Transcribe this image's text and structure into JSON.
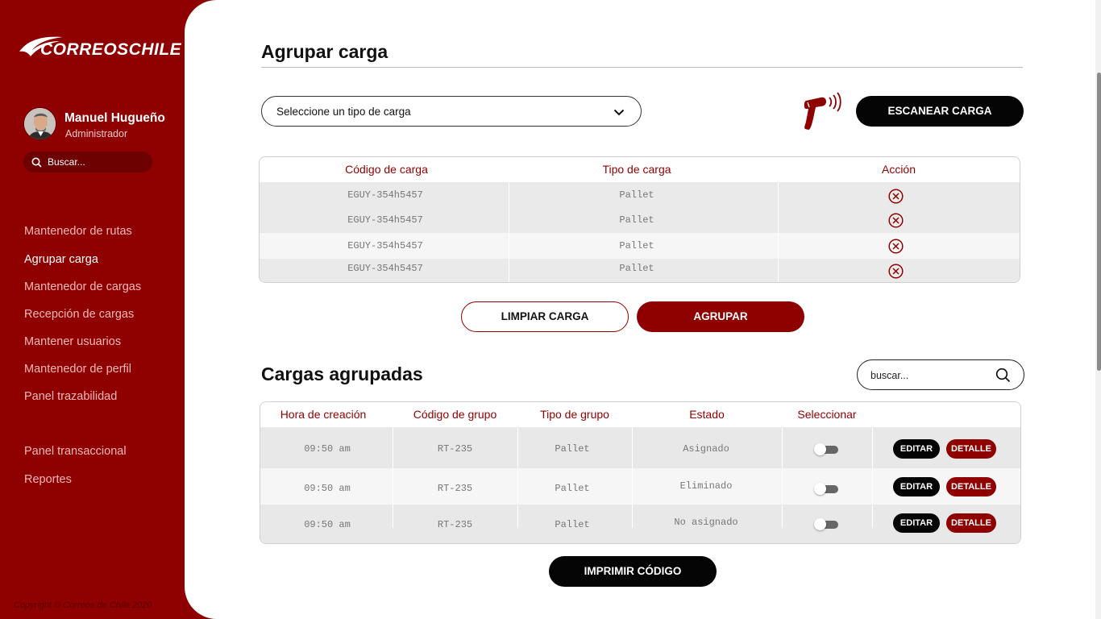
{
  "sidebar": {
    "brand": "CORREOSCHILE",
    "user": {
      "name": "Manuel Hugueño",
      "role": "Administrador"
    },
    "search": {
      "placeholder": "Buscar..."
    },
    "nav": [
      {
        "label": "Mantenedor de rutas",
        "active": false
      },
      {
        "label": "Agrupar carga",
        "active": true
      },
      {
        "label": "Mantenedor de cargas",
        "active": false
      },
      {
        "label": "Recepción de cargas",
        "active": false
      },
      {
        "label": "Mantener usuarios",
        "active": false
      },
      {
        "label": "Mantenedor de perfil",
        "active": false
      },
      {
        "label": "Panel trazabilidad",
        "active": false
      },
      {
        "label": "Panel transaccional",
        "active": false
      },
      {
        "label": "Reportes",
        "active": false
      }
    ],
    "copyright": "Copyright © Correos de Chile 2020"
  },
  "agrupar": {
    "title": "Agrupar carga",
    "select": {
      "value": "Seleccione un tipo de carga"
    },
    "scan_label": "ESCANEAR CARGA",
    "table": {
      "headers": [
        "Código de carga",
        "Tipo de carga",
        "Acción"
      ],
      "rows": [
        [
          "EGUY-354h5457",
          "Pallet"
        ],
        [
          "EGUY-354h5457",
          "Pallet"
        ],
        [
          "EGUY-354h5457",
          "Pallet"
        ],
        [
          "EGUY-354h5457",
          "Pallet"
        ]
      ]
    },
    "clear_label": "LIMPIAR CARGA",
    "group_label": "AGRUPAR"
  },
  "agrupadas": {
    "title": "Cargas agrupadas",
    "search": {
      "placeholder": "buscar..."
    },
    "table": {
      "headers": [
        "Hora de creación",
        "Código de grupo",
        "Tipo de grupo",
        "Estado",
        "Seleccionar"
      ],
      "rows": [
        {
          "hora": "09:50 am",
          "codigo": "RT-235",
          "tipo": "Pallet",
          "estado": "Asignado",
          "selected": false
        },
        {
          "hora": "09:50 am",
          "codigo": "RT-235",
          "tipo": "Pallet",
          "estado": "Eliminado",
          "selected": false
        },
        {
          "hora": "09:50 am",
          "codigo": "RT-235",
          "tipo": "Pallet",
          "estado": "No asignado",
          "selected": false
        }
      ],
      "edit_label": "EDITAR",
      "detail_label": "DETALLE"
    },
    "print_label": "IMPRIMIR CÓDIGO"
  },
  "colors": {
    "brand": "#8f0000",
    "black": "#050505",
    "row_alt": "#eaeaea",
    "row_light": "#f6f6f6"
  }
}
